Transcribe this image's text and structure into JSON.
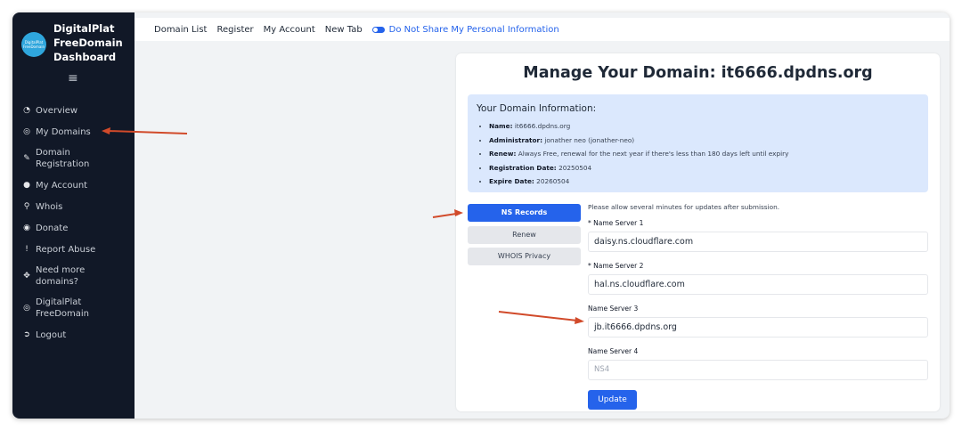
{
  "sidebar": {
    "brand_title": "DigitalPlat\nFreeDomain\nDashboard",
    "logo_text": "DigitalPlat FreeDomain",
    "menu_icon": "hamburger-icon",
    "items": [
      {
        "label": "Overview",
        "icon": "dashboard-icon"
      },
      {
        "label": "My Domains",
        "icon": "globe-icon"
      },
      {
        "label": "Domain Registration",
        "icon": "edit-icon"
      },
      {
        "label": "My Account",
        "icon": "user-icon"
      },
      {
        "label": "Whois",
        "icon": "search-icon"
      },
      {
        "label": "Donate",
        "icon": "donate-icon"
      },
      {
        "label": "Report Abuse",
        "icon": "exclamation-icon"
      },
      {
        "label": "Need more domains?",
        "icon": "move-icon"
      },
      {
        "label": "DigitalPlat FreeDomain",
        "icon": "globe-icon"
      },
      {
        "label": "Logout",
        "icon": "logout-icon"
      }
    ]
  },
  "topbar": {
    "links": [
      "Domain List",
      "Register",
      "My Account",
      "New Tab"
    ],
    "privacy_label": "Do Not Share My Personal Information",
    "privacy_icon": "toggle-icon"
  },
  "card": {
    "title": "Manage Your Domain: it6666.dpdns.org",
    "info_heading": "Your Domain Information:",
    "info": [
      {
        "key": "Name:",
        "value": "it6666.dpdns.org"
      },
      {
        "key": "Administrator:",
        "value": "jonather neo (jonather-neo)"
      },
      {
        "key": "Renew:",
        "value": "Always Free, renewal for the next year if there's less than 180 days left until expiry"
      },
      {
        "key": "Registration Date:",
        "value": "20250504"
      },
      {
        "key": "Expire Date:",
        "value": "20260504"
      }
    ]
  },
  "tabs": [
    "NS Records",
    "Renew",
    "WHOIS Privacy"
  ],
  "form": {
    "note": "Please allow several minutes for updates after submission.",
    "fields": [
      {
        "label": "* Name Server 1",
        "value": "daisy.ns.cloudflare.com",
        "placeholder": ""
      },
      {
        "label": "* Name Server 2",
        "value": "hal.ns.cloudflare.com",
        "placeholder": ""
      },
      {
        "label": "Name Server 3",
        "value": "jb.it6666.dpdns.org",
        "placeholder": ""
      },
      {
        "label": "Name Server 4",
        "value": "",
        "placeholder": "NS4"
      }
    ],
    "submit_label": "Update"
  },
  "colors": {
    "sidebar_bg": "#111827",
    "accent": "#2563eb",
    "info_bg": "#dbe8fd",
    "arrow": "#d14a2a"
  }
}
